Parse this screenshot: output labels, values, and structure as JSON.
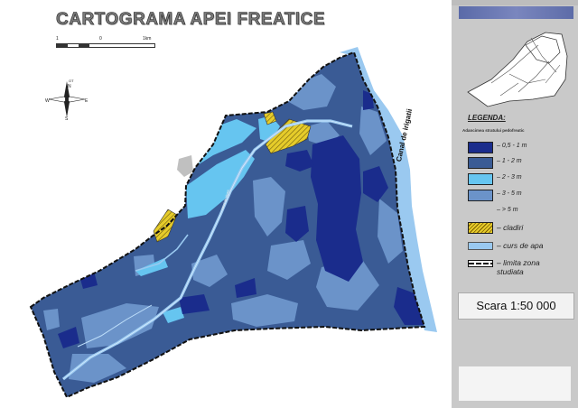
{
  "title": "CARTOGRAMA APEI FREATICE",
  "scale_bar": {
    "labels": [
      "1",
      "0",
      "1km"
    ]
  },
  "compass": {
    "labels": {
      "n": "N",
      "s": "S",
      "e": "E",
      "w": "W",
      "top": "OT"
    }
  },
  "map_labels": {
    "canal": "Canal de irigatii",
    "inner_channel": "canal de irigatii"
  },
  "legend": {
    "title": "LEGENDA:",
    "subtitle": "Adancimea stratului pedofreatic",
    "items": [
      {
        "label": "– 0,5 - 1 m",
        "color": "#1a2c8c",
        "kind": "fill"
      },
      {
        "label": "– 1 - 2 m",
        "color": "#3a5b95",
        "kind": "fill"
      },
      {
        "label": "– 2 - 3 m",
        "color": "#66c5f0",
        "kind": "fill"
      },
      {
        "label": "– 3 - 5 m",
        "color": "#6b93c9",
        "kind": "fill"
      },
      {
        "label": "– > 5 m",
        "color": "#c9c9c9",
        "kind": "none"
      },
      {
        "label": "– cladiri",
        "color": "#e6cc2a",
        "kind": "hatch"
      },
      {
        "label": "– curs de apa",
        "color": "#9ac9f0",
        "kind": "water"
      },
      {
        "label": "– limita zona studiata",
        "color": "#111111",
        "kind": "limit"
      }
    ]
  },
  "scale_text": "Scara 1:50 000",
  "colors": {
    "base": "#3a5b95",
    "dark": "#1a2c8c",
    "light": "#66c5f0",
    "medium": "#6b93c9",
    "water": "#9ac9f0",
    "building": "#e6cc2a",
    "sidebar": "#c9c9c9"
  }
}
